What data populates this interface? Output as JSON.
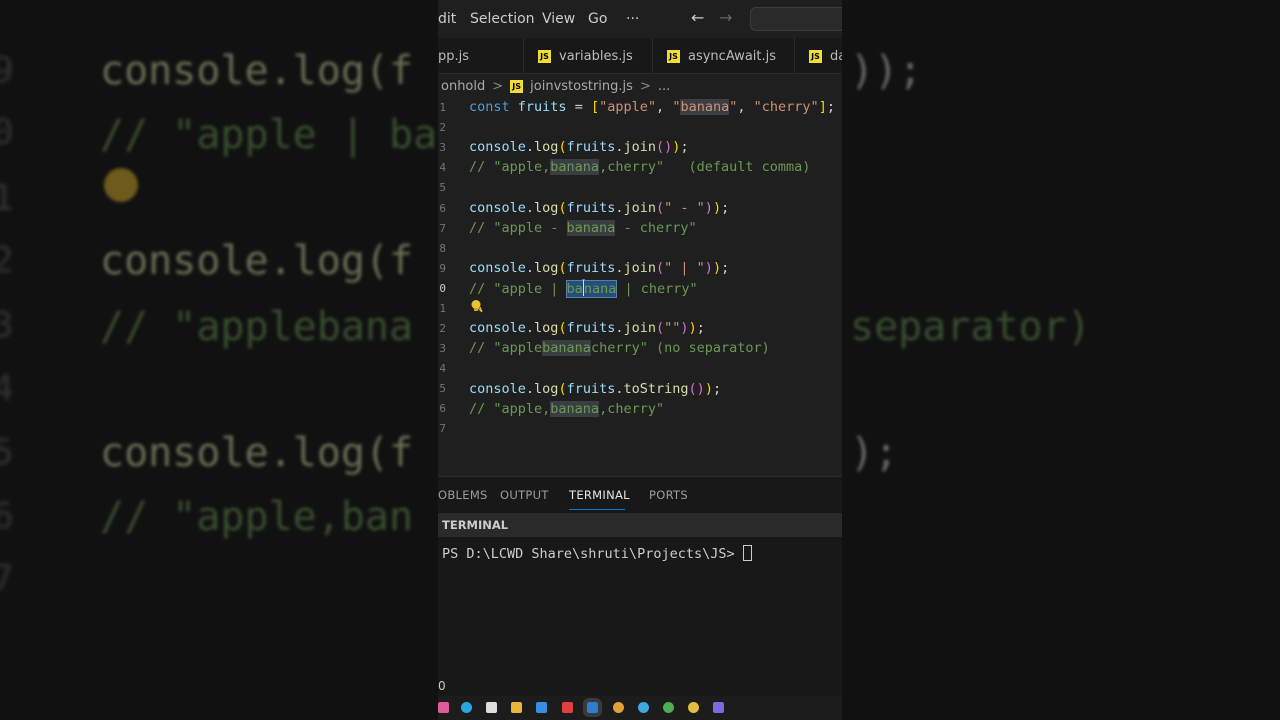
{
  "menu": {
    "edit": "dit",
    "selection": "Selection",
    "view": "View",
    "go": "Go",
    "more": "···"
  },
  "nav": {
    "back": "←",
    "forward": "→"
  },
  "tabs": [
    {
      "label": "pp.js"
    },
    {
      "label": "variables.js"
    },
    {
      "label": "asyncAwait.js"
    },
    {
      "label": "da"
    }
  ],
  "breadcrumb": {
    "folder": "onhold",
    "sep1": ">",
    "file": "joinvstostring.js",
    "sep2": ">",
    "ellipsis": "..."
  },
  "gutter": [
    "1",
    "2",
    "3",
    "4",
    "5",
    "6",
    "7",
    "8",
    "9",
    "0",
    "1",
    "2",
    "3",
    "4",
    "5",
    "6",
    "7"
  ],
  "code_lines": [
    "const fruits = [\"apple\", \"banana\", \"cherry\"];",
    "",
    "console.log(fruits.join());",
    "// \"apple,banana,cherry\"   (default comma)",
    "",
    "console.log(fruits.join(\" - \"));",
    "// \"apple - banana - cherry\"",
    "",
    "console.log(fruits.join(\" | \"));",
    "// \"apple | banana | cherry\"",
    "",
    "console.log(fruits.join(\"\"));",
    "// \"applebananacherry\" (no separator)",
    "",
    "console.log(fruits.toString());",
    "// \"apple,banana,cherry\"",
    ""
  ],
  "panel": {
    "tabs": [
      "OBLEMS",
      "OUTPUT",
      "TERMINAL",
      "PORTS"
    ],
    "active_tab": "TERMINAL",
    "terminal_title": "TERMINAL",
    "prompt": "PS D:\\LCWD Share\\shruti\\Projects\\JS> "
  },
  "status": {
    "count": "0"
  },
  "background": {
    "lines": [
      "console.log(f",
      "// \"apple | ba",
      "console.log(f",
      "// \"applebana",
      "console.log(f",
      "// \"apple,ban"
    ],
    "right": [
      "));",
      "separator)",
      ");"
    ],
    "gutter": [
      "9",
      "0",
      "1",
      "2",
      "3",
      "4",
      "5",
      "6",
      "7"
    ]
  },
  "colors": {
    "accent": "#0078d4",
    "js_icon": "#f1dd35"
  }
}
